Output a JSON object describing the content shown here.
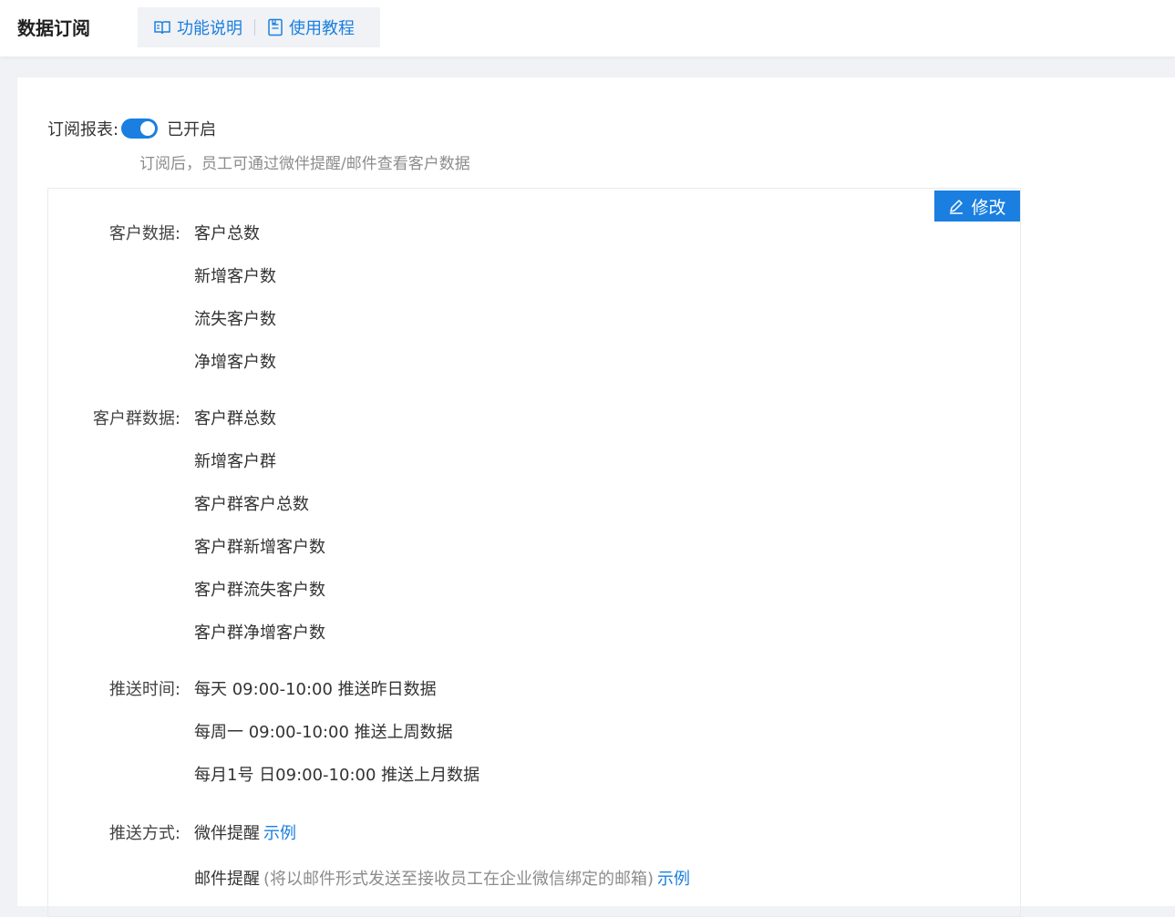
{
  "header": {
    "title": "数据订阅",
    "help_links": [
      "功能说明",
      "使用教程"
    ]
  },
  "subscription": {
    "label": "订阅报表:",
    "toggle_on": true,
    "status": "已开启",
    "hint": "订阅后，员工可通过微伴提醒/邮件查看客户数据"
  },
  "card": {
    "edit_label": "修改",
    "customer_data": {
      "label": "客户数据:",
      "items": [
        "客户总数",
        "新增客户数",
        "流失客户数",
        "净增客户数"
      ]
    },
    "group_data": {
      "label": "客户群数据:",
      "items": [
        "客户群总数",
        "新增客户群",
        "客户群客户总数",
        "客户群新增客户数",
        "客户群流失客户数",
        "客户群净增客户数"
      ]
    },
    "push_time": {
      "label": "推送时间:",
      "items": [
        "每天 09:00-10:00 推送昨日数据",
        "每周一 09:00-10:00 推送上周数据",
        "每月1号 日09:00-10:00 推送上月数据"
      ]
    },
    "push_method": {
      "label": "推送方式:",
      "wechat": "微伴提醒",
      "wechat_example": "示例",
      "email": "邮件提醒",
      "email_note": "(将以邮件形式发送至接收员工在企业微信绑定的邮箱)",
      "email_example": "示例"
    }
  },
  "colors": {
    "accent": "#1a7fe0",
    "background": "#f0f2f5"
  }
}
